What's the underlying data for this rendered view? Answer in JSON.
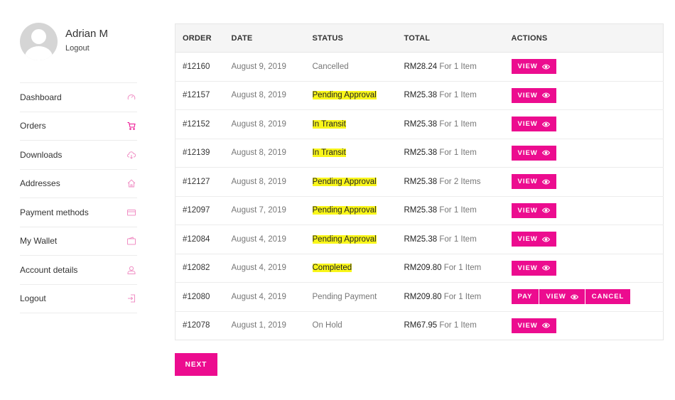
{
  "user": {
    "name": "Adrian M",
    "logout_label": "Logout"
  },
  "nav": [
    {
      "label": "Dashboard",
      "icon": "dashboard-icon"
    },
    {
      "label": "Orders",
      "icon": "cart-icon"
    },
    {
      "label": "Downloads",
      "icon": "cloud-download-icon"
    },
    {
      "label": "Addresses",
      "icon": "home-icon"
    },
    {
      "label": "Payment methods",
      "icon": "credit-card-icon"
    },
    {
      "label": "My Wallet",
      "icon": "wallet-icon"
    },
    {
      "label": "Account details",
      "icon": "user-icon"
    },
    {
      "label": "Logout",
      "icon": "logout-icon"
    }
  ],
  "table": {
    "headers": [
      "ORDER",
      "DATE",
      "STATUS",
      "TOTAL",
      "ACTIONS"
    ],
    "rows": [
      {
        "order": "#12160",
        "date": "August 9, 2019",
        "status": "Cancelled",
        "highlight": false,
        "amount": "RM28.24",
        "items": "For 1 Item",
        "actions": [
          "VIEW"
        ]
      },
      {
        "order": "#12157",
        "date": "August 8, 2019",
        "status": "Pending Approval",
        "highlight": true,
        "amount": "RM25.38",
        "items": "For 1 Item",
        "actions": [
          "VIEW"
        ]
      },
      {
        "order": "#12152",
        "date": "August 8, 2019",
        "status": "In Transit",
        "highlight": true,
        "amount": "RM25.38",
        "items": "For 1 Item",
        "actions": [
          "VIEW"
        ]
      },
      {
        "order": "#12139",
        "date": "August 8, 2019",
        "status": "In Transit",
        "highlight": true,
        "amount": "RM25.38",
        "items": "For 1 Item",
        "actions": [
          "VIEW"
        ]
      },
      {
        "order": "#12127",
        "date": "August 8, 2019",
        "status": "Pending Approval",
        "highlight": true,
        "amount": "RM25.38",
        "items": "For 2 Items",
        "actions": [
          "VIEW"
        ]
      },
      {
        "order": "#12097",
        "date": "August 7, 2019",
        "status": "Pending Approval",
        "highlight": true,
        "amount": "RM25.38",
        "items": "For 1 Item",
        "actions": [
          "VIEW"
        ]
      },
      {
        "order": "#12084",
        "date": "August 4, 2019",
        "status": "Pending Approval",
        "highlight": true,
        "amount": "RM25.38",
        "items": "For 1 Item",
        "actions": [
          "VIEW"
        ]
      },
      {
        "order": "#12082",
        "date": "August 4, 2019",
        "status": "Completed",
        "highlight": true,
        "amount": "RM209.80",
        "items": "For 1 Item",
        "actions": [
          "VIEW"
        ]
      },
      {
        "order": "#12080",
        "date": "August 4, 2019",
        "status": "Pending Payment",
        "highlight": false,
        "amount": "RM209.80",
        "items": "For 1 Item",
        "actions": [
          "PAY",
          "VIEW",
          "CANCEL"
        ]
      },
      {
        "order": "#12078",
        "date": "August 1, 2019",
        "status": "On Hold",
        "highlight": false,
        "amount": "RM67.95",
        "items": "For 1 Item",
        "actions": [
          "VIEW"
        ]
      }
    ]
  },
  "pagination": {
    "next_label": "NEXT"
  },
  "colors": {
    "accent": "#ec0c8f",
    "highlight": "#f9f61a",
    "nav_icon": "#f08fc4"
  }
}
